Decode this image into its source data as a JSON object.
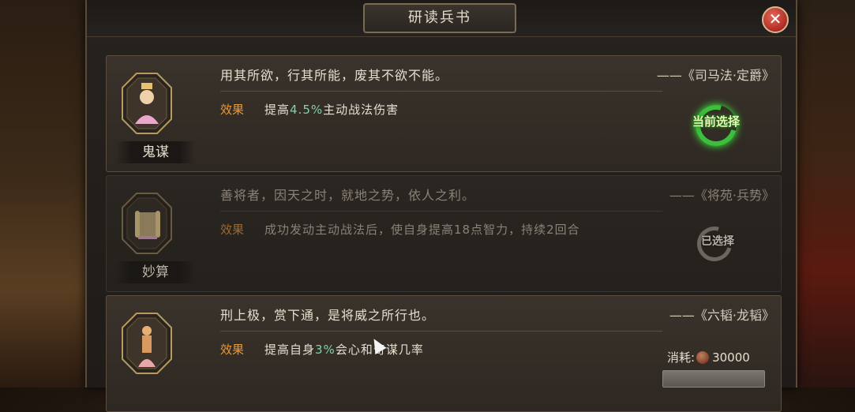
{
  "title": "研读兵书",
  "close_icon": "✕",
  "cards": [
    {
      "name": "鬼谋",
      "quote": "用其所欲，行其所能，废其不欲不能。",
      "source": "——《司马法·定爵》",
      "effect_label": "效果",
      "effect_pre": "提高",
      "effect_value": "4.5%",
      "effect_post": "主动战法伤害",
      "status": "当前选择",
      "portrait_icon": "strategist-portrait-icon"
    },
    {
      "name": "妙算",
      "quote": "善将者，因天之时，就地之势，依人之利。",
      "source": "——《将苑·兵势》",
      "effect_label": "效果",
      "effect_text": "成功发动主动战法后，使自身提高18点智力，持续2回合",
      "status": "已选择",
      "portrait_icon": "scroll-icon"
    },
    {
      "name": "",
      "quote": "刑上极，赏下通，是将威之所行也。",
      "source": "——《六韬·龙韬》",
      "effect_label": "效果",
      "effect_pre": "提高自身",
      "effect_value": "3%",
      "effect_post": "会心和奇谋几率",
      "cost_label": "消耗:",
      "cost_value": "30000",
      "portrait_icon": "statue-icon"
    }
  ],
  "colors": {
    "effect_label": "#e89a3a",
    "highlight": "#7fd3a8",
    "current_ring": "#3cbf3c"
  }
}
